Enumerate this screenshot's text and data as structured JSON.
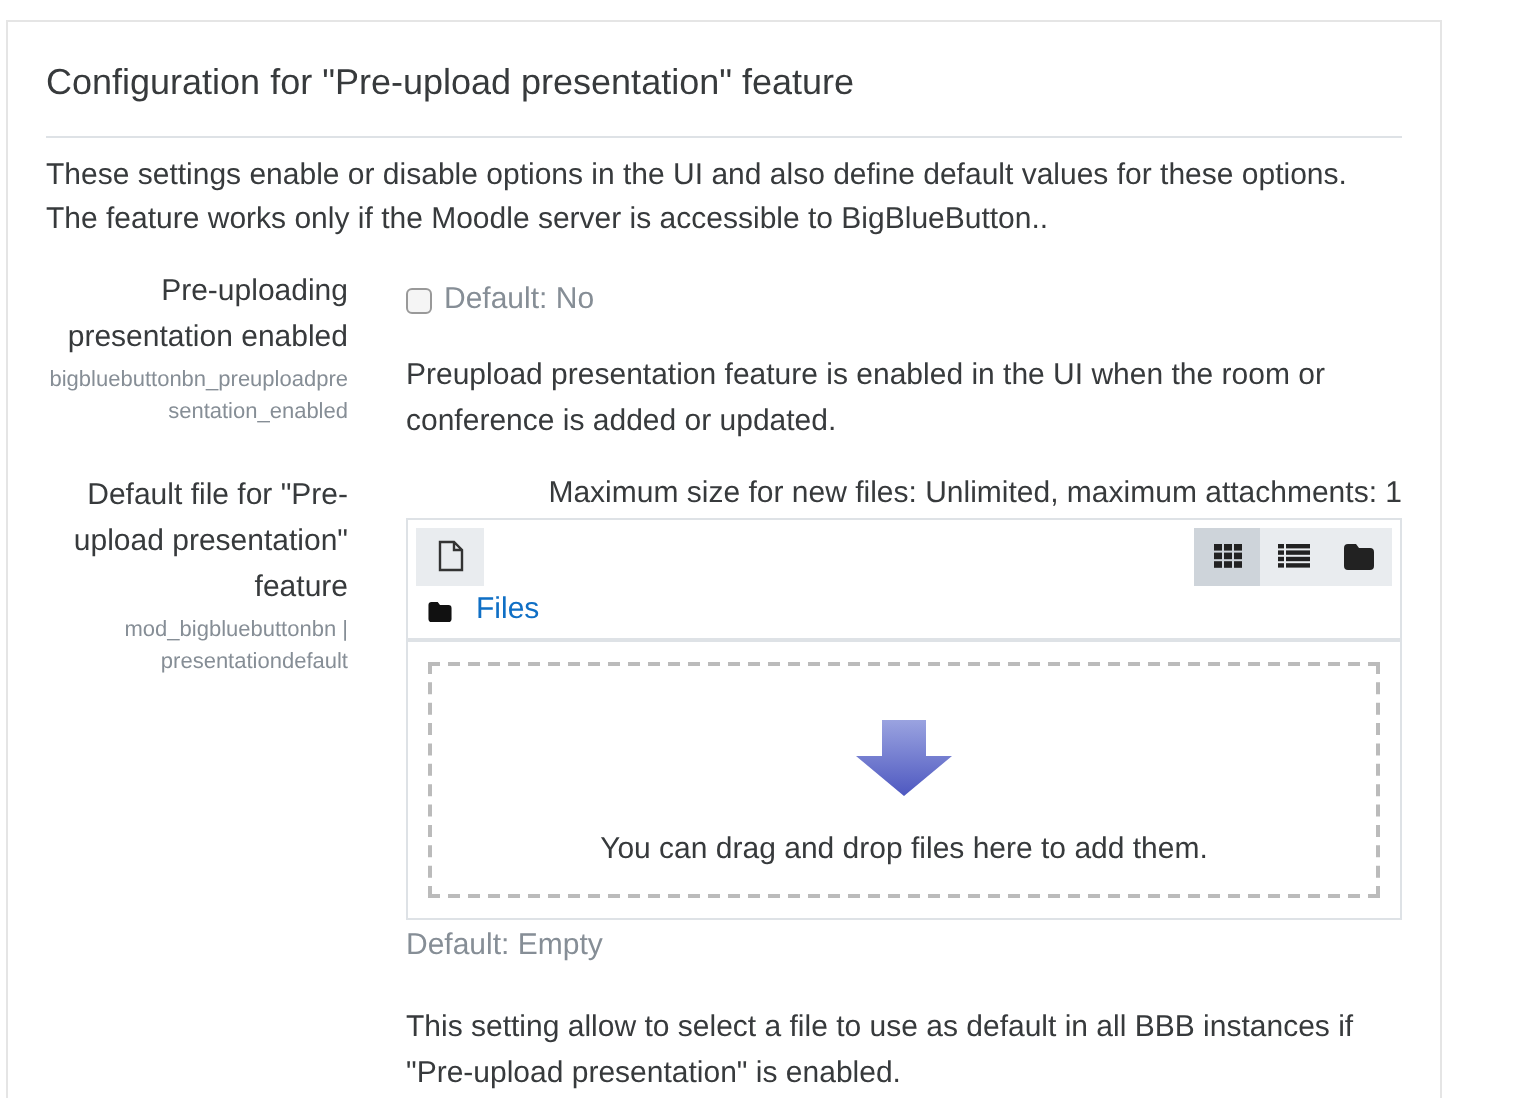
{
  "heading": "Configuration for \"Pre-upload presentation\" feature",
  "description": [
    "These settings enable or disable options in the UI and also define default values for these options.",
    "The feature works only if the Moodle server is accessible to BigBlueButton.."
  ],
  "settings": [
    {
      "kind": "checkbox",
      "label": "Pre-uploading presentation enabled",
      "key": "bigbluebuttonbn_preuploadpresentation_enabled",
      "checked": false,
      "default": "Default: No",
      "help": "Preupload presentation feature is enabled in the UI when the room or conference is added or updated."
    },
    {
      "kind": "filepicker",
      "label": "Default file for \"Pre-upload presentation\" feature",
      "key": "mod_bigbluebuttonbn | presentationdefault",
      "limits": "Maximum size for new files: Unlimited, maximum attachments: 1",
      "path": "Files",
      "views": [
        {
          "kind": "grid",
          "selected": true
        },
        {
          "kind": "list",
          "selected": false
        },
        {
          "kind": "tree",
          "selected": false
        }
      ],
      "drop_text": "You can drag and drop files here to add them.",
      "default": "Default: Empty",
      "help": "This setting allow to select a file to use as default in all BBB instances if \"Pre-upload presentation\" is enabled."
    }
  ]
}
